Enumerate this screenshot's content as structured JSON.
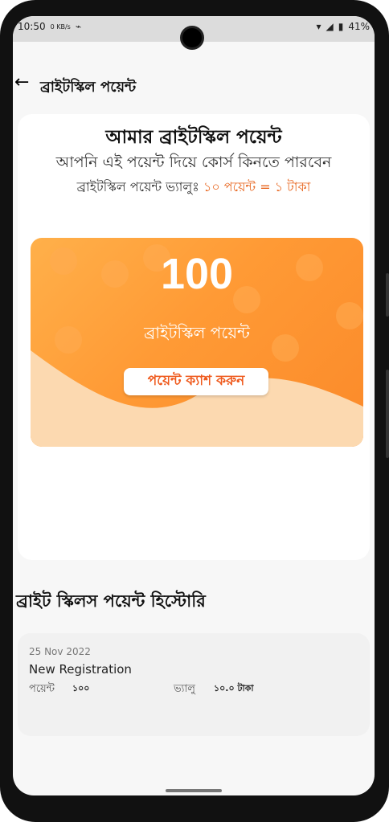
{
  "status_bar": {
    "time": "10:50",
    "speed": "0 KB/s",
    "battery": "41%"
  },
  "appbar": {
    "title": "ব্রাইটস্কিল পয়েন্ট"
  },
  "points_card": {
    "heading": "আমার ব্রাইটস্কিল পয়েন্ট",
    "subtitle": "আপনি এই পয়েন্ট দিয়ে কোর্স কিনতে পারবেন",
    "value_label": "ব্রাইটস্কিল পয়েন্ট ভ্যালুঃ",
    "value_text": "১০ পয়েন্ট = ১ টাকা",
    "points": "100",
    "points_label": "ব্রাইটস্কিল পয়েন্ট",
    "cash_button": "পয়েন্ট ক্যাশ করুন"
  },
  "history": {
    "title": "ব্রাইট স্কিলস পয়েন্ট হিস্টোরি",
    "items": [
      {
        "date": "25 Nov 2022",
        "description": "New Registration",
        "point_label": "পয়েন্ট",
        "point_value": "১০০",
        "value_label": "ভ্যালু",
        "value_value": "১০.০ টাকা"
      }
    ]
  },
  "colors": {
    "accent": "#f7882c",
    "value_text": "#e8661f"
  }
}
